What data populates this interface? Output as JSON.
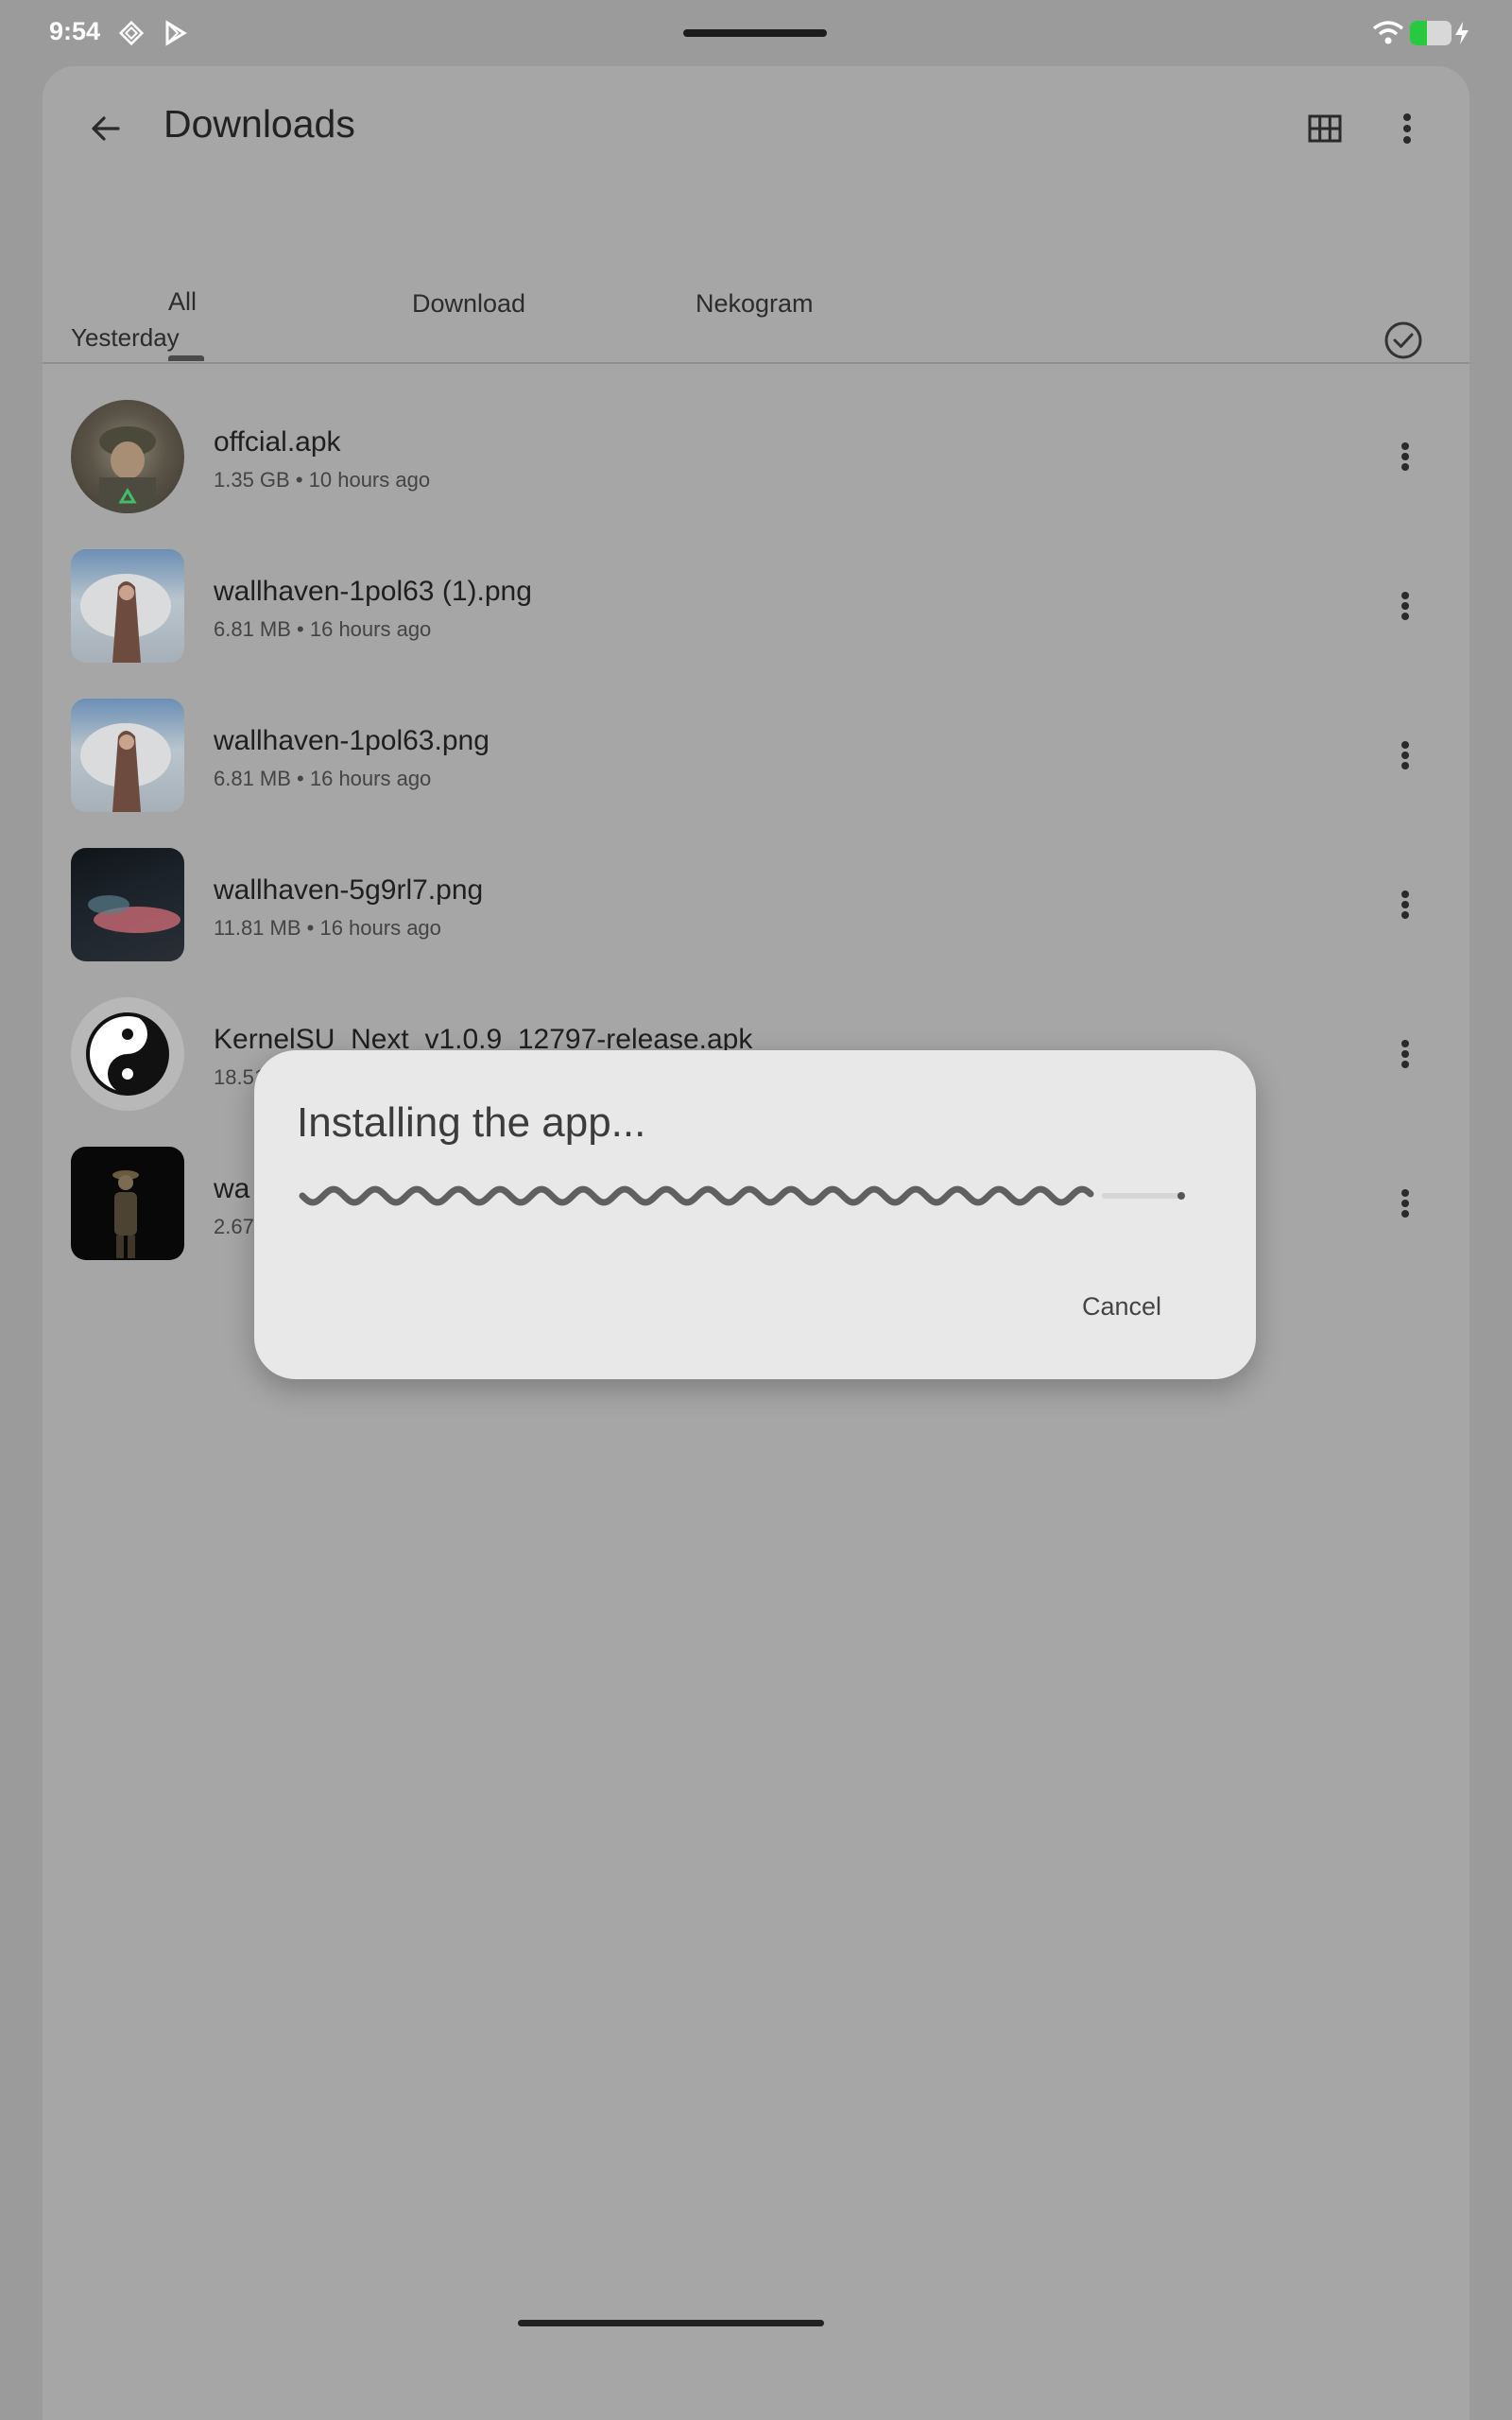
{
  "status_bar": {
    "time": "9:54",
    "battery_level": 0.4,
    "icons": [
      "notification-diamond-icon",
      "play-store-icon",
      "wifi-icon",
      "battery-icon",
      "charging-icon"
    ]
  },
  "app_bar": {
    "title": "Downloads",
    "icons": [
      "back-arrow-icon",
      "grid-view-icon",
      "more-vert-icon"
    ]
  },
  "tabs": [
    {
      "label": "All",
      "selected": true
    },
    {
      "label": "Download",
      "selected": false
    },
    {
      "label": "Nekogram",
      "selected": false
    }
  ],
  "section": {
    "label": "Yesterday"
  },
  "files": [
    {
      "name": "offcial.apk",
      "meta": "1.35 GB • 10 hours ago"
    },
    {
      "name": "wallhaven-1pol63 (1).png",
      "meta": "6.81 MB • 16 hours ago"
    },
    {
      "name": "wallhaven-1pol63.png",
      "meta": "6.81 MB • 16 hours ago"
    },
    {
      "name": "wallhaven-5g9rl7.png",
      "meta": "11.81 MB • 16 hours ago"
    },
    {
      "name": "KernelSU_Next_v1.0.9_12797-release.apk",
      "meta": "18.51"
    },
    {
      "name": "wa",
      "meta": "2.67"
    }
  ],
  "dialog": {
    "title": "Installing the app...",
    "progress": 0.93,
    "cancel_label": "Cancel"
  },
  "colors": {
    "scrim": "#9b9b9b",
    "dialog_bg": "#e8e8e8",
    "progress": "#606060",
    "battery": "#27c93f"
  }
}
